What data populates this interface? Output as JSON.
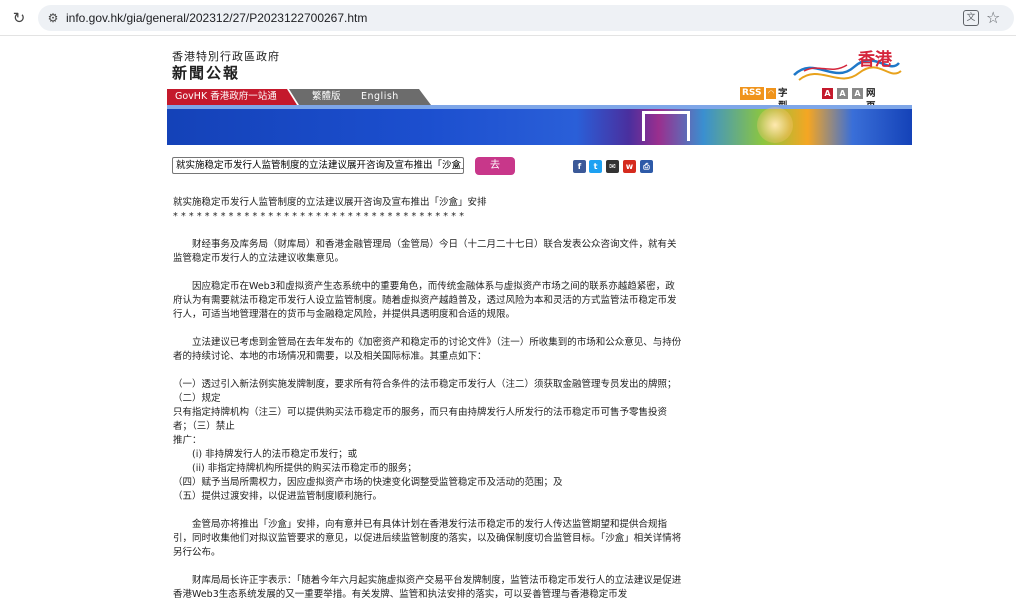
{
  "browser": {
    "url": "info.gov.hk/gia/general/202312/27/P2023122700267.htm"
  },
  "header": {
    "gov_name": "香港特別行政區政府",
    "press_title": "新聞公報",
    "logo_text": "香港",
    "nav": {
      "govhk": "GovHK 香港政府一站通",
      "traditional": "繁體版",
      "english": "English"
    },
    "tools": {
      "rss": "RSS",
      "font_size_label": "字型大小:",
      "font_small": "A",
      "font_medium": "A",
      "font_large": "A",
      "guide": "网页指南"
    }
  },
  "controls": {
    "select_value": "就实施稳定币发行人监管制度的立法建议展开咨询及宣布推出「沙盒」安排",
    "go_label": "去",
    "share": {
      "facebook": "f",
      "twitter": "t",
      "email": "✉",
      "weibo": "w",
      "print": "⎙"
    }
  },
  "article": {
    "headline": "就实施稳定币发行人监管制度的立法建议展开咨询及宣布推出「沙盒」安排",
    "stars": "*************************************",
    "p1": "财经事务及库务局（财库局）和香港金融管理局（金管局）今日（十二月二十七日）联合发表公众咨询文件，就有关监管稳定币发行人的立法建议收集意见。",
    "p2": "因应稳定币在Web3和虚拟资产生态系统中的重要角色，而传统金融体系与虚拟资产市场之间的联系亦越趋紧密，政府认为有需要就法币稳定币发行人设立监管制度。随着虚拟资产越趋普及，透过风险为本和灵活的方式监管法币稳定币发行人，可适当地管理潜在的货币与金融稳定风险，并提供具透明度和合适的规限。",
    "p3": "立法建议已考虑到金管局在去年发布的《加密资产和稳定币的讨论文件》（注一）所收集到的市场和公众意见、与持份者的持续讨论、本地的市场情况和需要，以及相关国际标准。其重点如下：",
    "list_line1": "（一）透过引入新法例实施发牌制度，要求所有符合条件的法币稳定币发行人（注二）须获取金融管理专员发出的牌照；（二）规定",
    "list_line2": "只有指定持牌机构（注三）可以提供购买法币稳定币的服务，而只有由持牌发行人所发行的法币稳定币可售予零售投资者；（三）禁止",
    "list_line3": "推广：",
    "list_sub1": "(i) 非持牌发行人的法币稳定币发行；或",
    "list_sub2": "(ii) 非指定持牌机构所提供的购买法币稳定币的服务；",
    "list_line4": "（四）赋予当局所需权力，因应虚拟资产市场的快速变化调整受监管稳定币及活动的范围；及",
    "list_line5": "（五）提供过渡安排，以促进监管制度顺利施行。",
    "p4": "金管局亦将推出「沙盒」安排，向有意并已有具体计划在香港发行法币稳定币的发行人传达监管期望和提供合规指引，同时收集他们对拟议监管要求的意见，以促进后续监管制度的落实，以及确保制度切合监管目标。「沙盒」相关详情将另行公布。",
    "p5": "财库局局长许正宇表示：「随着今年六月起实施虚拟资产交易平台发牌制度，监管法币稳定币发行人的立法建议是促进香港Web3生态系统发展的又一重要举措。有关发牌、监管和执法安排的落实，可以妥善管理与香港稳定币发"
  }
}
